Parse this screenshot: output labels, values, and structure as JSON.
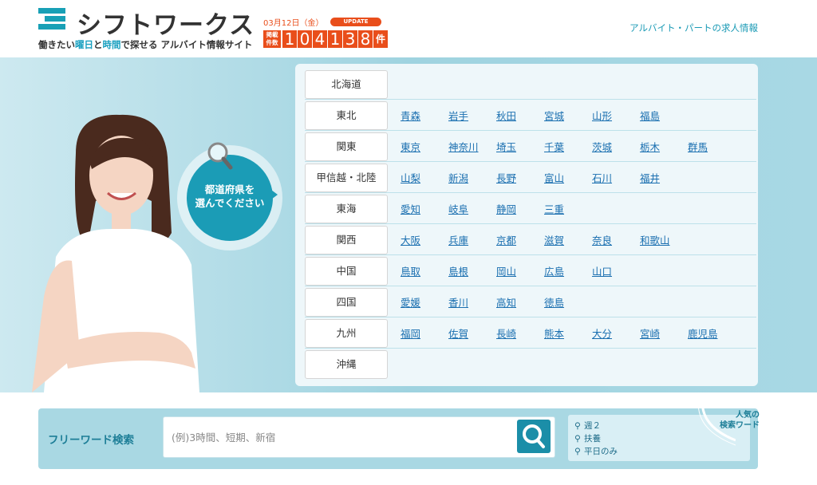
{
  "header": {
    "logo_name": "シフトワークス",
    "tagline_pre": "働きたい",
    "tagline_hl1": "曜日",
    "tagline_mid": "と",
    "tagline_hl2": "時間",
    "tagline_post": "で探せる アルバイト情報サイト",
    "date": "03月12日（金）",
    "update_badge": "UPDATE",
    "count_label": "掲載件数",
    "count_digits": [
      "1",
      "0",
      "4",
      "1",
      "3",
      "8"
    ],
    "count_unit": "件",
    "right_link": "アルバイト・パートの求人情報"
  },
  "hero": {
    "bubble_line1": "都道府県を",
    "bubble_line2": "選んでください"
  },
  "regions": [
    {
      "name": "北海道",
      "prefs": []
    },
    {
      "name": "東北",
      "prefs": [
        "青森",
        "岩手",
        "秋田",
        "宮城",
        "山形",
        "福島"
      ]
    },
    {
      "name": "関東",
      "prefs": [
        "東京",
        "神奈川",
        "埼玉",
        "千葉",
        "茨城",
        "栃木",
        "群馬"
      ]
    },
    {
      "name": "甲信越・北陸",
      "prefs": [
        "山梨",
        "新潟",
        "長野",
        "富山",
        "石川",
        "福井"
      ]
    },
    {
      "name": "東海",
      "prefs": [
        "愛知",
        "岐阜",
        "静岡",
        "三重"
      ]
    },
    {
      "name": "関西",
      "prefs": [
        "大阪",
        "兵庫",
        "京都",
        "滋賀",
        "奈良",
        "和歌山"
      ]
    },
    {
      "name": "中国",
      "prefs": [
        "鳥取",
        "島根",
        "岡山",
        "広島",
        "山口"
      ]
    },
    {
      "name": "四国",
      "prefs": [
        "愛媛",
        "香川",
        "高知",
        "徳島"
      ]
    },
    {
      "name": "九州",
      "prefs": [
        "福岡",
        "佐賀",
        "長崎",
        "熊本",
        "大分",
        "宮崎",
        "鹿児島"
      ]
    },
    {
      "name": "沖縄",
      "prefs": []
    }
  ],
  "search": {
    "label": "フリーワード検索",
    "placeholder": "(例)3時間、短期、新宿",
    "popular_title_1": "人気の",
    "popular_title_2": "検索ワード",
    "popular": [
      "週２",
      "扶養",
      "平日のみ"
    ]
  },
  "colors": {
    "brand": "#18a0b6",
    "accent": "#e94e1b",
    "link": "#1a6fb0"
  }
}
